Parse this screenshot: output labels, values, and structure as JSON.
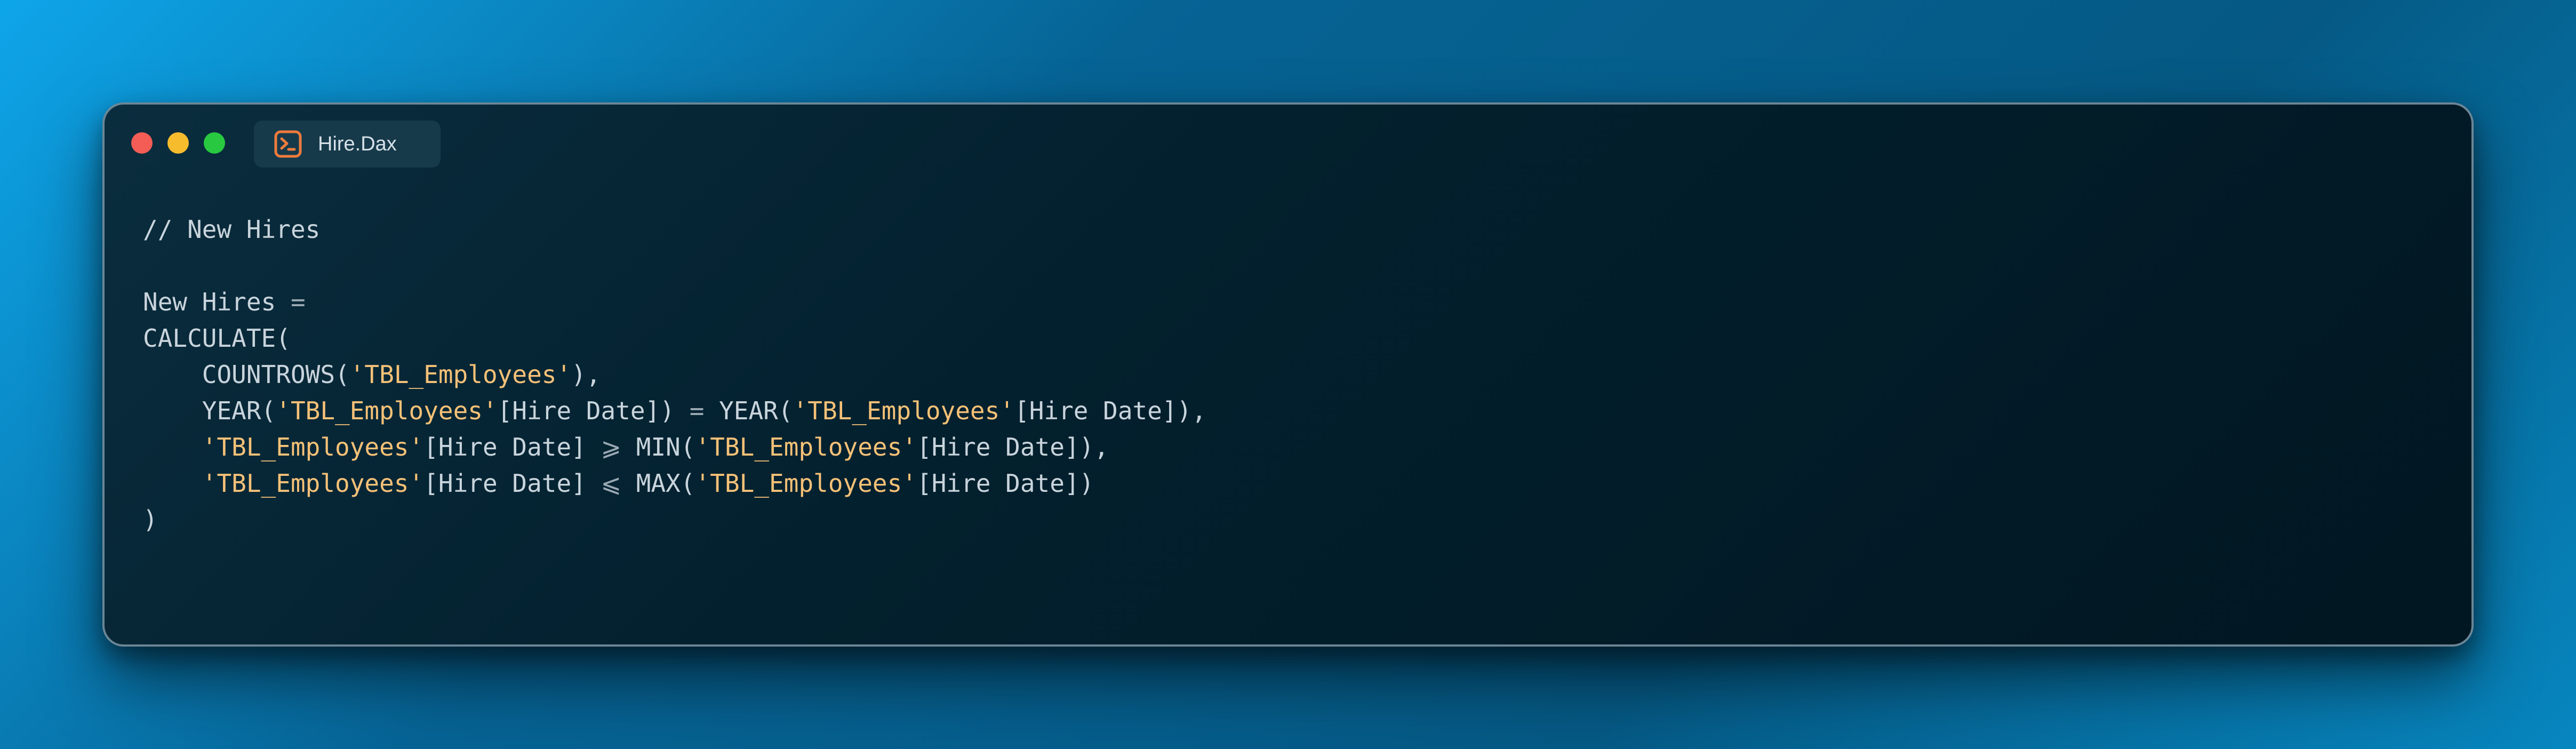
{
  "window": {
    "tab_label": "Hire.Dax",
    "tab_icon": "terminal-icon"
  },
  "colors": {
    "string": "#f6c177",
    "text": "#c9d4dc",
    "close_dot": "#f45c56",
    "minimize_dot": "#f7bc2d",
    "maximize_dot": "#28c840"
  },
  "code": {
    "l1": {
      "c": "// New Hires"
    },
    "l3": {
      "a": "New Hires ",
      "op": "="
    },
    "l4": {
      "a": "CALCULATE("
    },
    "l5": {
      "a": "    COUNTROWS(",
      "s1": "'TBL_Employees'",
      "b": "),"
    },
    "l6": {
      "a": "    YEAR(",
      "s1": "'TBL_Employees'",
      "b": "[Hire Date]) ",
      "op": "=",
      "c": " YEAR(",
      "s2": "'TBL_Employees'",
      "d": "[Hire Date]),"
    },
    "l7": {
      "a": "    ",
      "s1": "'TBL_Employees'",
      "b": "[Hire Date] ",
      "op": "⩾",
      "c": " MIN(",
      "s2": "'TBL_Employees'",
      "d": "[Hire Date]),"
    },
    "l8": {
      "a": "    ",
      "s1": "'TBL_Employees'",
      "b": "[Hire Date] ",
      "op": "⩽",
      "c": " MAX(",
      "s2": "'TBL_Employees'",
      "d": "[Hire Date])"
    },
    "l9": {
      "a": ")"
    }
  }
}
